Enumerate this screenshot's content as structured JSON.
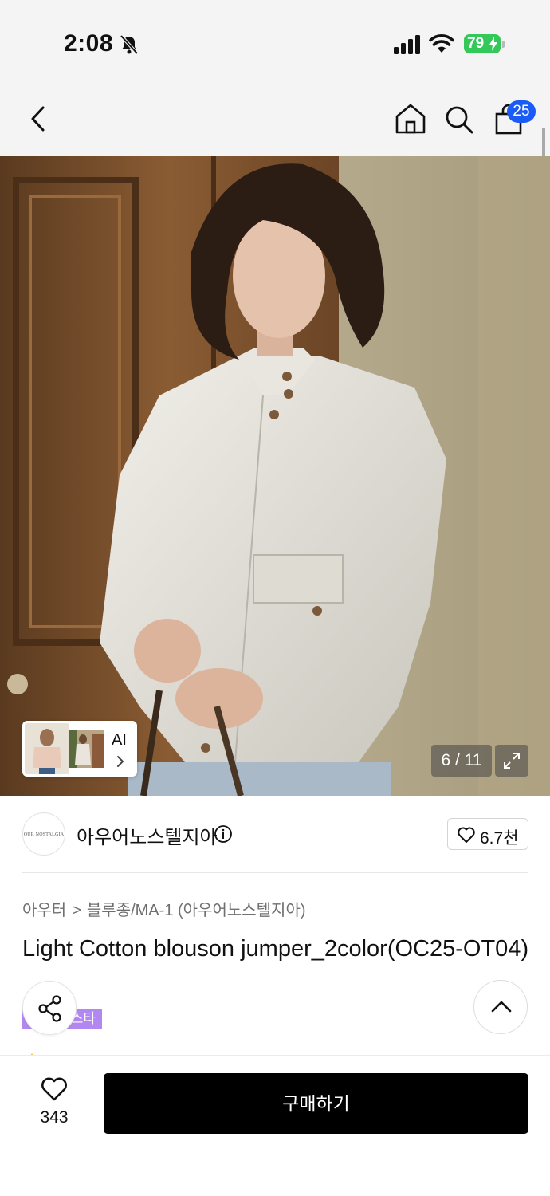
{
  "status_bar": {
    "time": "2:08",
    "battery": "79",
    "icons": [
      "bell-slash-icon",
      "cellular-signal-icon",
      "wifi-icon",
      "battery-charging-icon"
    ]
  },
  "nav": {
    "icons": [
      "back-chevron-icon",
      "home-icon",
      "search-icon",
      "shopping-bag-icon"
    ],
    "cart_count": "25"
  },
  "gallery": {
    "ai_label": "AI",
    "counter": "6 / 11",
    "expand_icon": "expand-arrows-icon"
  },
  "brand": {
    "logo_text": "OUR NOSTALGIA",
    "name": "아우어노스텔지아",
    "like_count": "6.7천"
  },
  "product": {
    "breadcrumb": [
      "아우터",
      "블루종/MA-1 (아우어노스텔지아)"
    ],
    "breadcrumb_separator": ">",
    "title": "Light Cotton blouson jumper_2color(OC25-OT04)",
    "tag": "스타"
  },
  "bottom_bar": {
    "like_count": "343",
    "buy_label": "구매하기"
  },
  "colors": {
    "accent_badge": "#1a5af5",
    "battery_green": "#34c759",
    "tag_purple": "#b387f1",
    "buy_button": "#000000"
  }
}
